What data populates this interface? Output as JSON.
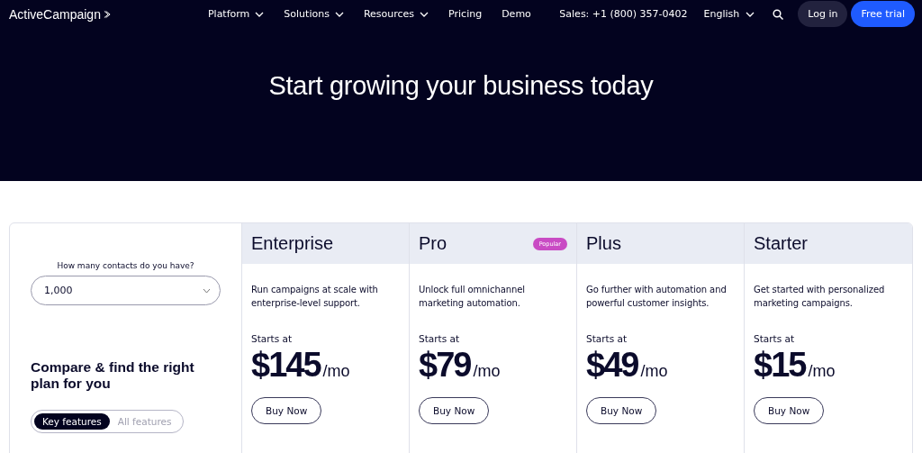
{
  "header": {
    "logo": "ActiveCampaign",
    "nav": [
      {
        "label": "Platform",
        "dropdown": true
      },
      {
        "label": "Solutions",
        "dropdown": true
      },
      {
        "label": "Resources",
        "dropdown": true
      },
      {
        "label": "Pricing",
        "dropdown": false
      },
      {
        "label": "Demo",
        "dropdown": false
      }
    ],
    "sales": "Sales: +1 (800) 357-0402",
    "language": "English",
    "login": "Log in",
    "trial": "Free trial"
  },
  "hero": {
    "title": "Start growing your business today"
  },
  "compare": {
    "contacts_label": "How many contacts do you have?",
    "contacts_value": "1,000",
    "heading": "Compare & find the right plan for you",
    "toggle": [
      {
        "label": "Key features",
        "selected": true
      },
      {
        "label": "All features",
        "selected": false
      }
    ]
  },
  "plans": [
    {
      "name": "Enterprise",
      "description": "Run campaigns at scale with enterprise-level support.",
      "starts": "Starts at",
      "price": "$145",
      "period": "/mo",
      "button": "Buy Now"
    },
    {
      "name": "Pro",
      "badge": "Popular",
      "description": "Unlock full omnichannel marketing automation.",
      "starts": "Starts at",
      "price": "$79",
      "period": "/mo",
      "button": "Buy Now"
    },
    {
      "name": "Plus",
      "description": "Go further with automation and powerful customer insights.",
      "starts": "Starts at",
      "price": "$49",
      "period": "/mo",
      "button": "Buy Now"
    },
    {
      "name": "Starter",
      "description": "Get started with personalized marketing campaigns.",
      "starts": "Starts at",
      "price": "$15",
      "period": "/mo",
      "button": "Buy Now"
    }
  ]
}
